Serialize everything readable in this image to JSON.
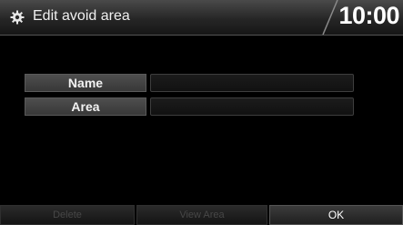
{
  "header": {
    "title": "Edit avoid area",
    "clock": "10:00",
    "icon": "gear-icon"
  },
  "form": {
    "rows": [
      {
        "label": "Name",
        "value": ""
      },
      {
        "label": "Area",
        "value": ""
      }
    ]
  },
  "buttons": {
    "delete": "Delete",
    "view_area": "View Area",
    "ok": "OK"
  },
  "colors": {
    "background": "#000000",
    "header": "#2a2a2a",
    "label_bg": "#444444",
    "field_bg": "#161616",
    "disabled_text": "#474747",
    "text": "#ffffff"
  }
}
